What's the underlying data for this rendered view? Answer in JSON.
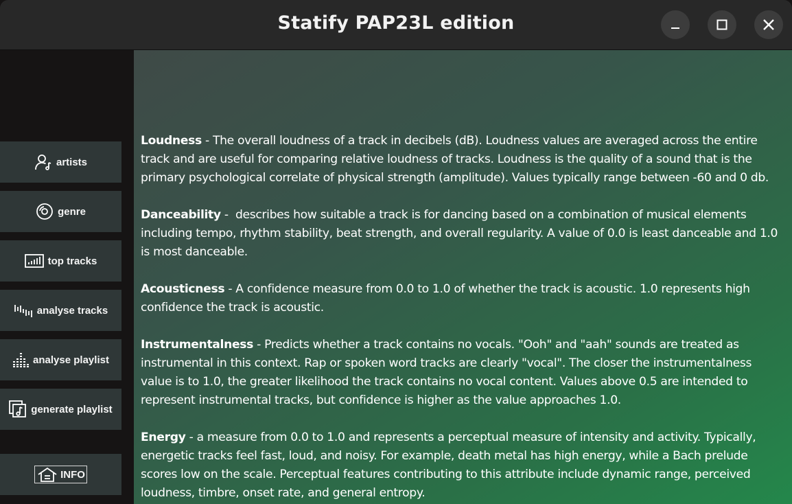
{
  "window": {
    "title": "Statify PAP23L edition",
    "controls": [
      "minimize-icon",
      "maximize-icon",
      "close-icon"
    ]
  },
  "sidebar": {
    "items": [
      {
        "label": "artists",
        "icon": "user-music-icon"
      },
      {
        "label": "genre",
        "icon": "disc-icon"
      },
      {
        "label": "top tracks",
        "icon": "bar-chart-icon"
      },
      {
        "label": "analyse tracks",
        "icon": "waveform-icon"
      },
      {
        "label": "analyse playlist",
        "icon": "equalizer-icon"
      },
      {
        "label": "generate playlist",
        "icon": "music-file-icon"
      }
    ],
    "info": {
      "label": "INFO",
      "icon": "home-icon"
    }
  },
  "info": {
    "paragraphs": [
      {
        "term": "Loudness",
        "text": " - The overall loudness of a track in decibels (dB). Loudness values are averaged across the entire track and are useful for comparing relative loudness of tracks. Loudness is the quality of a sound that is the primary psychological correlate of physical strength (amplitude). Values typically range between -60 and 0 db."
      },
      {
        "term": "Danceability",
        "text": " -  describes how suitable a track is for dancing based on a combination of musical elements including tempo, rhythm stability, beat strength, and overall regularity. A value of 0.0 is least danceable and 1.0 is most danceable."
      },
      {
        "term": "Acousticness",
        "text": " - A confidence measure from 0.0 to 1.0 of whether the track is acoustic. 1.0 represents high confidence the track is acoustic."
      },
      {
        "term": "Instrumentalness",
        "text": " - Predicts whether a track contains no vocals. \"Ooh\" and \"aah\" sounds are treated as instrumental in this context. Rap or spoken word tracks are clearly \"vocal\". The closer the instrumentalness value is to 1.0, the greater likelihood the track contains no vocal content. Values above 0.5 are intended to represent instrumental tracks, but confidence is higher as the value approaches 1.0."
      },
      {
        "term": "Energy",
        "text": " - a measure from 0.0 to 1.0 and represents a perceptual measure of intensity and activity. Typically, energetic tracks feel fast, loud, and noisy. For example, death metal has high energy, while a Bach prelude scores low on the scale. Perceptual features contributing to this attribute include dynamic range, perceived loudness, timbre, onset rate, and general entropy."
      }
    ]
  },
  "colors": {
    "sidebar_bg": "#161414",
    "button_bg": "#2f3737",
    "titlebar_bg": "#282828",
    "gradient_start": "#3f4a47",
    "gradient_end": "#24874b"
  }
}
